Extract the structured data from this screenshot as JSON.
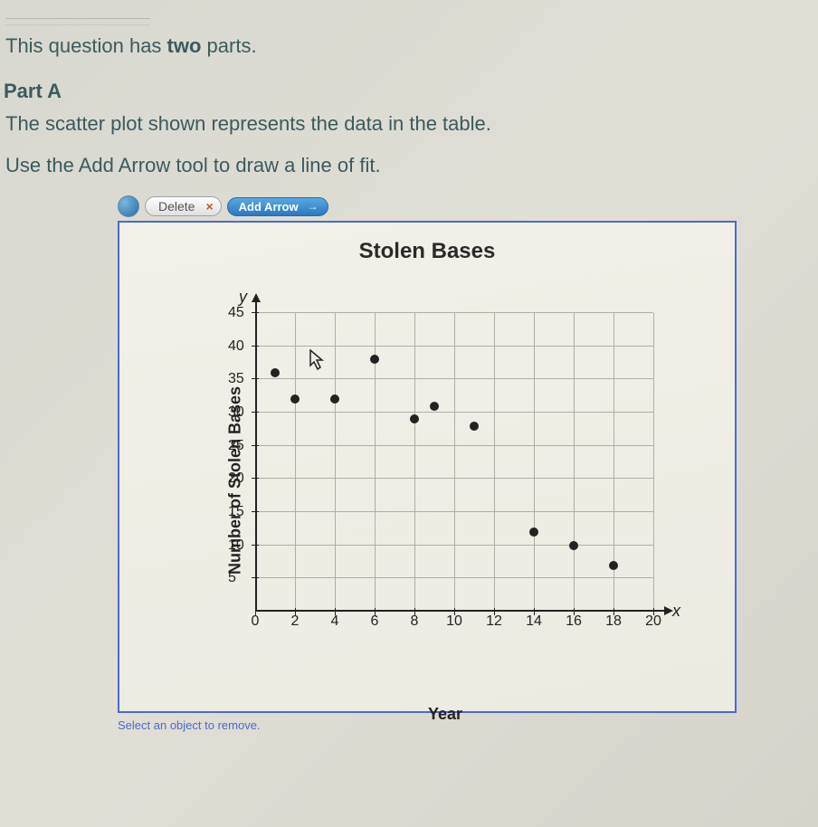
{
  "question": {
    "intro_pre": "This question has ",
    "intro_bold": "two",
    "intro_post": " parts.",
    "part_label": "Part A",
    "line1": "The scatter plot shown represents the data in the table.",
    "line2": "Use the Add Arrow tool to draw a line of fit."
  },
  "toolbar": {
    "delete_label": "Delete",
    "delete_x": "×",
    "addarrow_label": "Add Arrow",
    "arrow_glyph": "→"
  },
  "status": "Select an object to remove.",
  "chart_data": {
    "type": "scatter",
    "title": "Stolen Bases",
    "xlabel": "Year",
    "ylabel": "Number of Stolen Bases",
    "y_axis_letter": "y",
    "x_axis_letter": "x",
    "xlim": [
      0,
      20
    ],
    "ylim": [
      0,
      45
    ],
    "x_ticks": [
      0,
      2,
      4,
      6,
      8,
      10,
      12,
      14,
      16,
      18,
      20
    ],
    "y_ticks": [
      5,
      10,
      15,
      20,
      25,
      30,
      35,
      40,
      45
    ],
    "x_grid_step": 2,
    "y_grid_step": 5,
    "series": [
      {
        "name": "stolen_bases",
        "points": [
          {
            "x": 1,
            "y": 36
          },
          {
            "x": 2,
            "y": 32
          },
          {
            "x": 4,
            "y": 32
          },
          {
            "x": 6,
            "y": 38
          },
          {
            "x": 8,
            "y": 29
          },
          {
            "x": 9,
            "y": 31
          },
          {
            "x": 11,
            "y": 28
          },
          {
            "x": 14,
            "y": 12
          },
          {
            "x": 16,
            "y": 10
          },
          {
            "x": 18,
            "y": 7
          }
        ]
      }
    ]
  }
}
